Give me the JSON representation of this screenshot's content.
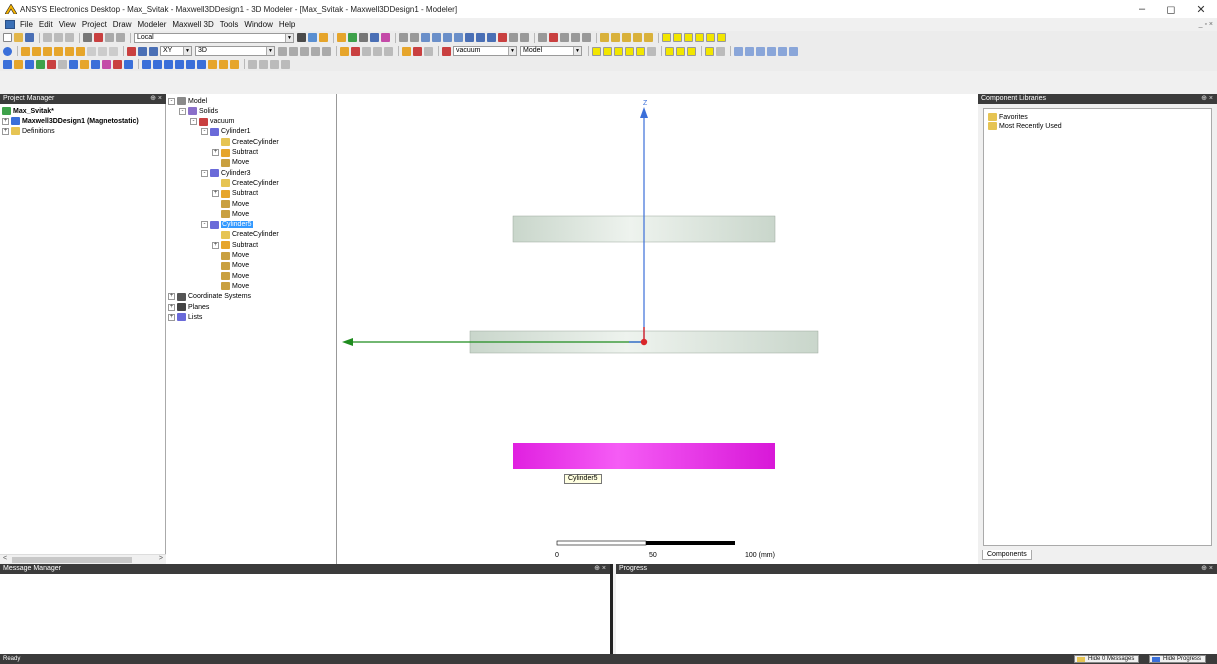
{
  "window": {
    "title": "ANSYS Electronics Desktop - Max_Svitak - Maxwell3DDesign1 - 3D Modeler - [Max_Svitak - Maxwell3DDesign1 - Modeler]",
    "minimize": "–",
    "maximize": "◻",
    "close": "✕"
  },
  "menu": [
    "File",
    "Edit",
    "View",
    "Project",
    "Draw",
    "Modeler",
    "Maxwell 3D",
    "Tools",
    "Window",
    "Help"
  ],
  "mdi_controls": "_ ▫ ×",
  "toolbar": {
    "coord_system": "Local",
    "plane": "XY",
    "dimension": "3D",
    "material": "vacuum",
    "mode": "Model"
  },
  "project_manager": {
    "header": "Project Manager",
    "pin": "⊕ ×",
    "project": "Max_Svitak*",
    "design": "Maxwell3DDesign1 (Magnetostatic)",
    "definitions": "Definitions"
  },
  "model_tree": [
    {
      "label": "Model",
      "level": 0,
      "exp": "-",
      "icon": "model"
    },
    {
      "label": "Solids",
      "level": 1,
      "exp": "-",
      "icon": "solids"
    },
    {
      "label": "vacuum",
      "level": 2,
      "exp": "-",
      "icon": "material"
    },
    {
      "label": "Cylinder1",
      "level": 3,
      "exp": "-",
      "icon": "object"
    },
    {
      "label": "CreateCylinder",
      "level": 4,
      "exp": "",
      "icon": "create"
    },
    {
      "label": "Subtract",
      "level": 4,
      "exp": "+",
      "icon": "subtract"
    },
    {
      "label": "Move",
      "level": 4,
      "exp": "",
      "icon": "move"
    },
    {
      "label": "Cylinder3",
      "level": 3,
      "exp": "-",
      "icon": "object"
    },
    {
      "label": "CreateCylinder",
      "level": 4,
      "exp": "",
      "icon": "create"
    },
    {
      "label": "Subtract",
      "level": 4,
      "exp": "+",
      "icon": "subtract"
    },
    {
      "label": "Move",
      "level": 4,
      "exp": "",
      "icon": "move"
    },
    {
      "label": "Move",
      "level": 4,
      "exp": "",
      "icon": "move"
    },
    {
      "label": "Cylinder5",
      "level": 3,
      "exp": "-",
      "icon": "object",
      "selected": true
    },
    {
      "label": "CreateCylinder",
      "level": 4,
      "exp": "",
      "icon": "create"
    },
    {
      "label": "Subtract",
      "level": 4,
      "exp": "+",
      "icon": "subtract"
    },
    {
      "label": "Move",
      "level": 4,
      "exp": "",
      "icon": "move"
    },
    {
      "label": "Move",
      "level": 4,
      "exp": "",
      "icon": "move"
    },
    {
      "label": "Move",
      "level": 4,
      "exp": "",
      "icon": "move"
    },
    {
      "label": "Move",
      "level": 4,
      "exp": "",
      "icon": "move"
    },
    {
      "label": "Coordinate Systems",
      "level": 0,
      "exp": "+",
      "icon": "cs"
    },
    {
      "label": "Planes",
      "level": 0,
      "exp": "+",
      "icon": "planes"
    },
    {
      "label": "Lists",
      "level": 0,
      "exp": "+",
      "icon": "lists"
    }
  ],
  "viewport": {
    "axis_z_label": "Z",
    "tooltip": "Cylinder5",
    "scale": {
      "t0": "0",
      "t1": "50",
      "t2": "100 (mm)"
    },
    "colors": {
      "cylinder": "#dde5de",
      "selected": "#e81ee8",
      "z_axis": "#3b6fd9",
      "x_axis": "#1f8c1f",
      "origin": "#d9262a"
    }
  },
  "component_libraries": {
    "header": "Component Libraries",
    "pin": "⊕ ×",
    "items": [
      "Favorites",
      "Most Recently Used"
    ],
    "tab": "Components"
  },
  "message_manager": {
    "header": "Message Manager",
    "pin": "⊕ ×"
  },
  "progress": {
    "header": "Progress",
    "pin": "⊕ ×"
  },
  "status": {
    "text": "Ready",
    "hide_messages": "Hide 0 Messages",
    "hide_progress": "Hide Progress"
  }
}
